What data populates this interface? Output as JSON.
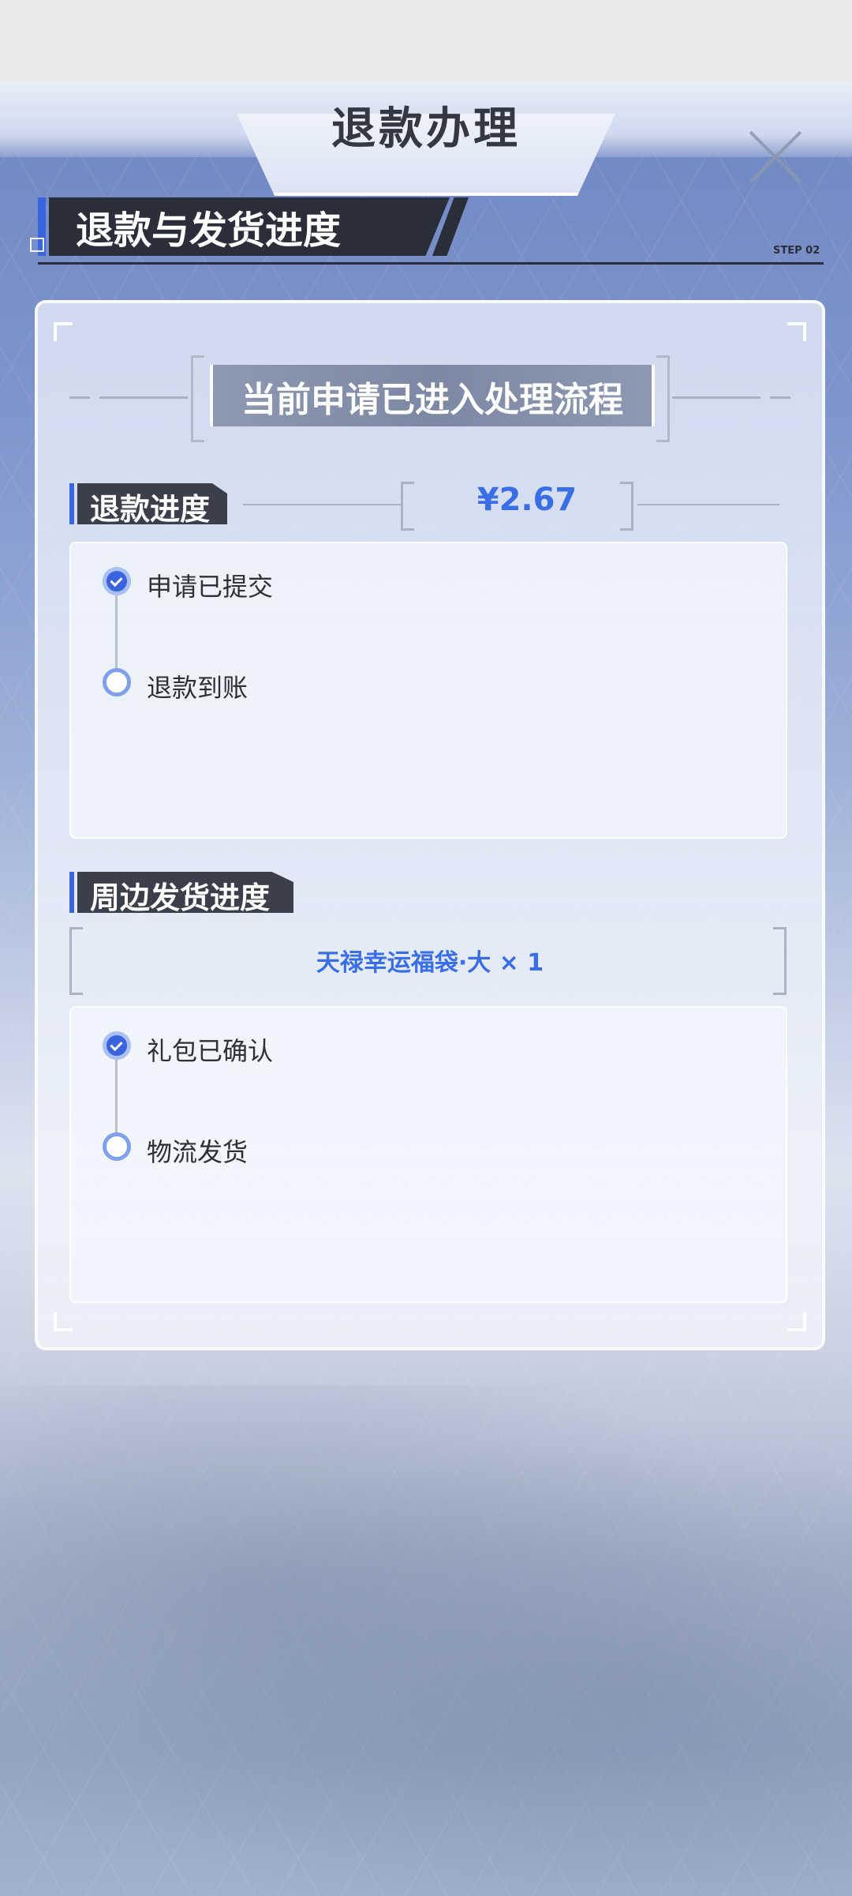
{
  "header": {
    "title": "退款办理"
  },
  "section": {
    "title": "退款与发货进度",
    "step_label": "STEP 02"
  },
  "status_banner": {
    "text": "当前申请已进入处理流程"
  },
  "refund": {
    "title": "退款进度",
    "amount": "¥2.67",
    "steps": [
      {
        "label": "申请已提交",
        "done": true
      },
      {
        "label": "退款到账",
        "done": false
      }
    ]
  },
  "shipping": {
    "title": "周边发货进度",
    "product": "天禄幸运福袋·大 × 1",
    "steps": [
      {
        "label": "礼包已确认",
        "done": true
      },
      {
        "label": "物流发货",
        "done": false
      }
    ]
  },
  "colors": {
    "accent": "#3a63e0",
    "amount": "#3a6ee6",
    "header_dark": "#2a2e3a"
  },
  "icons": {
    "close": "close-icon",
    "check": "check-icon"
  }
}
